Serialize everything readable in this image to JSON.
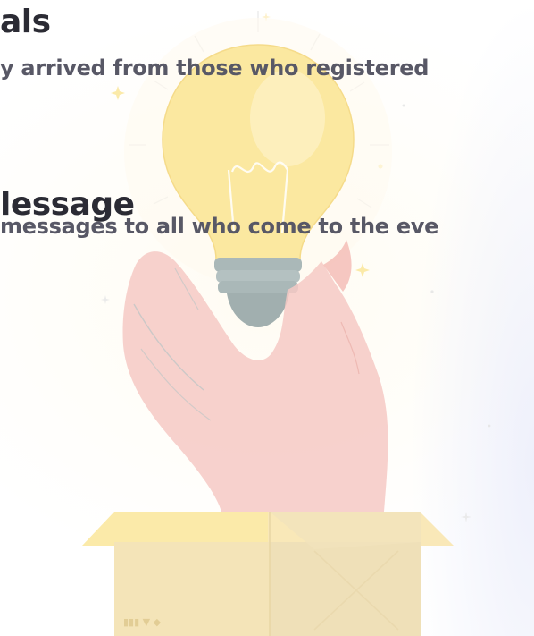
{
  "section_one": {
    "heading": "als",
    "description": "y arrived from those who registered"
  },
  "section_two": {
    "heading": "lessage",
    "description": "messages to all who come to the eve"
  },
  "box_label": "▮▮▮ ▼ ◆",
  "colors": {
    "heading": "#2b2b34",
    "description": "#585866",
    "bulb": "#fbe8a0",
    "hand": "#f6c9c4",
    "box": "#f2e4bd",
    "screw": "#aab8b8"
  },
  "icons": [
    "lightbulb-icon",
    "hand-icon",
    "cardboard-box-icon",
    "sparkle-icon"
  ]
}
